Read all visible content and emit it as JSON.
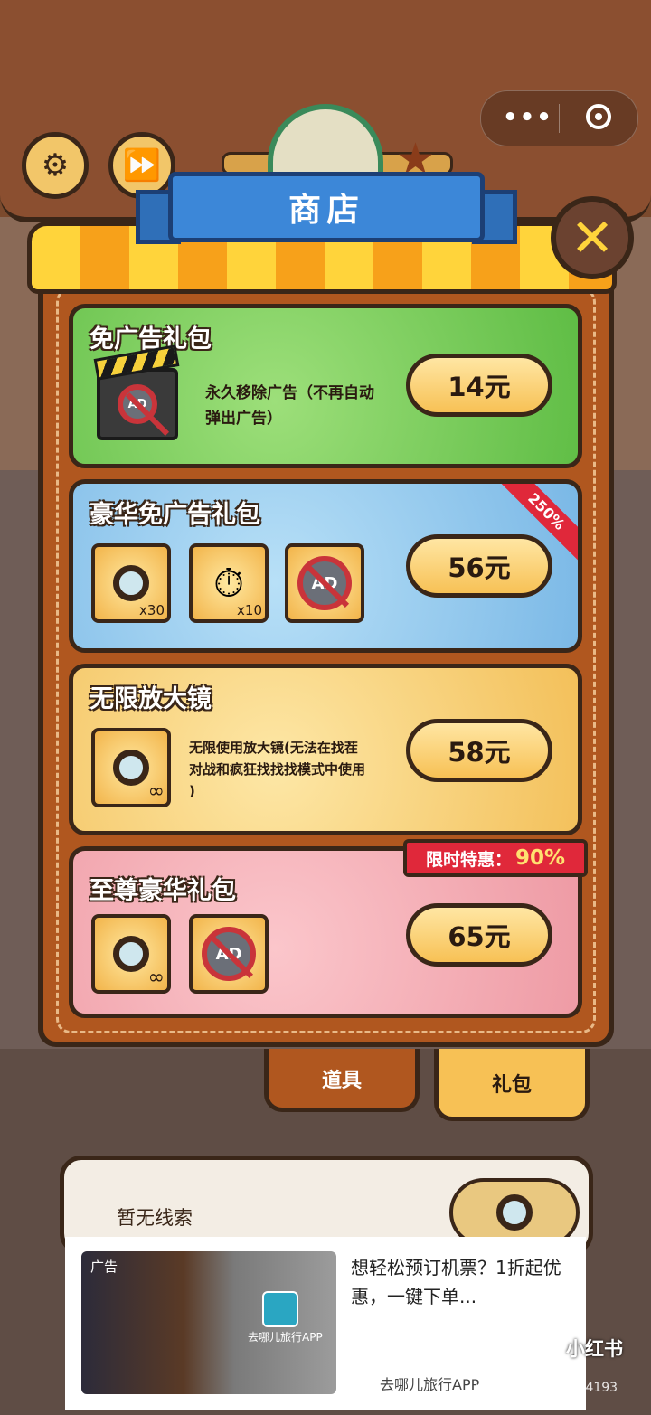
{
  "top": {
    "settings_icon": "gear-icon",
    "fast_forward_icon": "fast-forward-icon",
    "menu_dots": "•••",
    "record_icon": "record-icon"
  },
  "shop": {
    "title": "商店",
    "close_icon": "close-icon"
  },
  "packages": [
    {
      "title": "免广告礼包",
      "desc_line1": "永久移除广告（不再自动",
      "desc_line2": "弹出广告）",
      "price": "14元"
    },
    {
      "title": "豪华免广告礼包",
      "badge": "250%",
      "item1_count": "x30",
      "item2_count": "x10",
      "price": "56元"
    },
    {
      "title": "无限放大镜",
      "desc_line1": "无限使用放大镜(无法在找茬",
      "desc_line2": "对战和疯狂找找找模式中使用",
      "desc_line3": ")",
      "price": "58元"
    },
    {
      "title": "至尊豪华礼包",
      "limit_label": "限时特惠：",
      "limit_pct": "90%",
      "price": "65元"
    }
  ],
  "tabs": {
    "items": "道具",
    "gifts": "礼包"
  },
  "clue": {
    "text": "暂无线索"
  },
  "ad": {
    "label": "广告",
    "app_name": "去哪儿旅行APP",
    "headline": "想轻松预订机票？1折起优惠，一键下单...",
    "source": "去哪儿旅行APP"
  },
  "watermark": {
    "brand": "小红书",
    "id": "小红书号：2679784193"
  },
  "colors": {
    "price_button": "#f7c155",
    "green_card": "#7ccf5a",
    "blue_card": "#8cc8ee",
    "yellow_card": "#f7cf72",
    "pink_card": "#f4a9b2",
    "accent_red": "#e0283a"
  }
}
